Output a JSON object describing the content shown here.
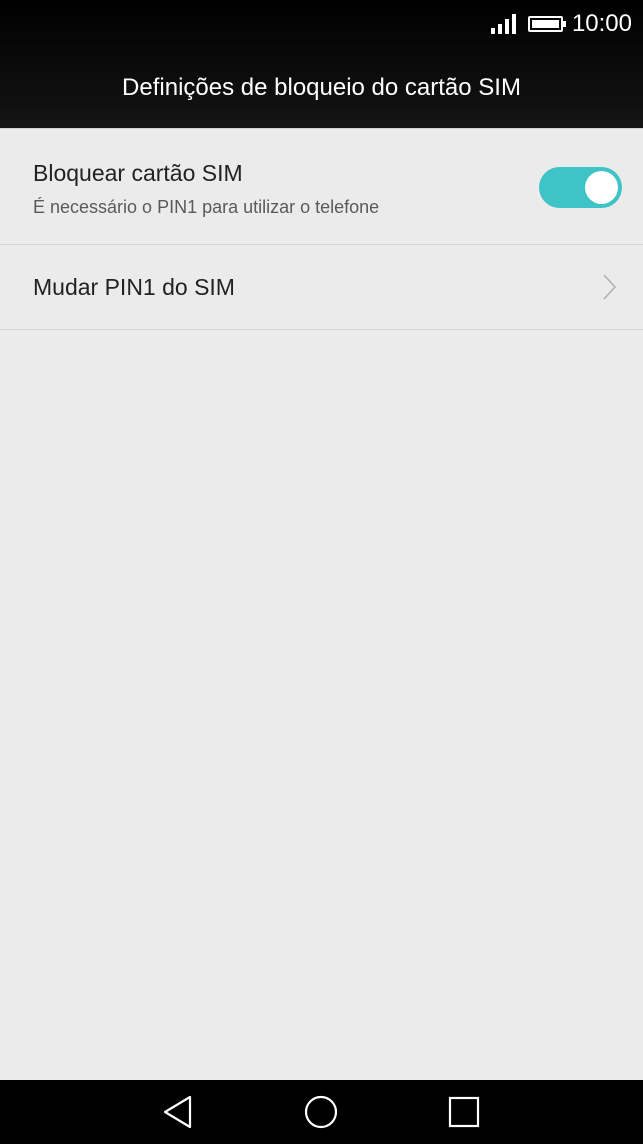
{
  "status_bar": {
    "time": "10:00",
    "signal_icon": "signal-icon",
    "battery_icon": "battery-icon"
  },
  "header": {
    "title": "Definições de bloqueio do cartão SIM"
  },
  "settings": {
    "lock_sim": {
      "title": "Bloquear cartão SIM",
      "subtitle": "É necessário o PIN1 para utilizar o telefone",
      "enabled": true
    },
    "change_pin": {
      "title": "Mudar PIN1 do SIM",
      "icon": "chevron-right-icon"
    }
  },
  "nav_bar": {
    "back_icon": "back-icon",
    "home_icon": "home-icon",
    "recent_icon": "recent-apps-icon"
  },
  "colors": {
    "accent": "#3ec4c6",
    "background": "#ebebeb",
    "header": "#000000"
  }
}
